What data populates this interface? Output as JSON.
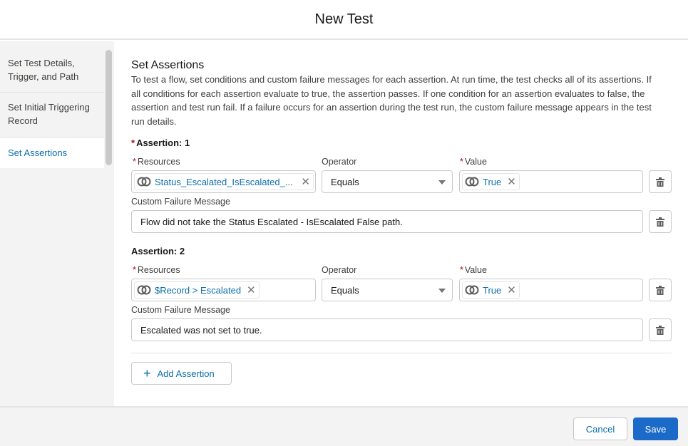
{
  "header": {
    "title": "New Test"
  },
  "sidebar": {
    "items": [
      {
        "label": "Set Test Details, Trigger, and Path",
        "active": false
      },
      {
        "label": "Set Initial Triggering Record",
        "active": false
      },
      {
        "label": "Set Assertions",
        "active": true
      }
    ]
  },
  "main": {
    "title": "Set Assertions",
    "description": "To test a flow, set conditions and custom failure messages for each assertion. At run time, the test checks all of its assertions. If all conditions for each assertion evaluate to true, the assertion passes. If one condition for an assertion evaluates to false, the assertion and test run fail. If a failure occurs for an assertion during the test run, the custom failure message appears in the test run details.",
    "labels": {
      "required_marker": "*",
      "resources": "Resources",
      "operator": "Operator",
      "value": "Value",
      "custom_failure_message": "Custom Failure Message"
    },
    "assertions": [
      {
        "title": "Assertion: 1",
        "required": true,
        "resource": "Status_Escalated_IsEscalated_...",
        "operator": "Equals",
        "value": "True",
        "failure_message": "Flow did not take the Status Escalated - IsEscalated False path."
      },
      {
        "title": "Assertion: 2",
        "required": false,
        "resource": "$Record > Escalated",
        "operator": "Equals",
        "value": "True",
        "failure_message": "Escalated was not set to true."
      }
    ],
    "add_assertion_label": "Add Assertion"
  },
  "footer": {
    "cancel_label": "Cancel",
    "save_label": "Save"
  },
  "icons": {
    "resource_pill": "resource-link-icon",
    "remove": "close-icon",
    "delete": "trash-icon",
    "dropdown": "caret-down-icon",
    "add": "plus-icon"
  },
  "colors": {
    "accent": "#0b6eab",
    "primary_button": "#1b6ac9",
    "required": "#ba0517"
  }
}
